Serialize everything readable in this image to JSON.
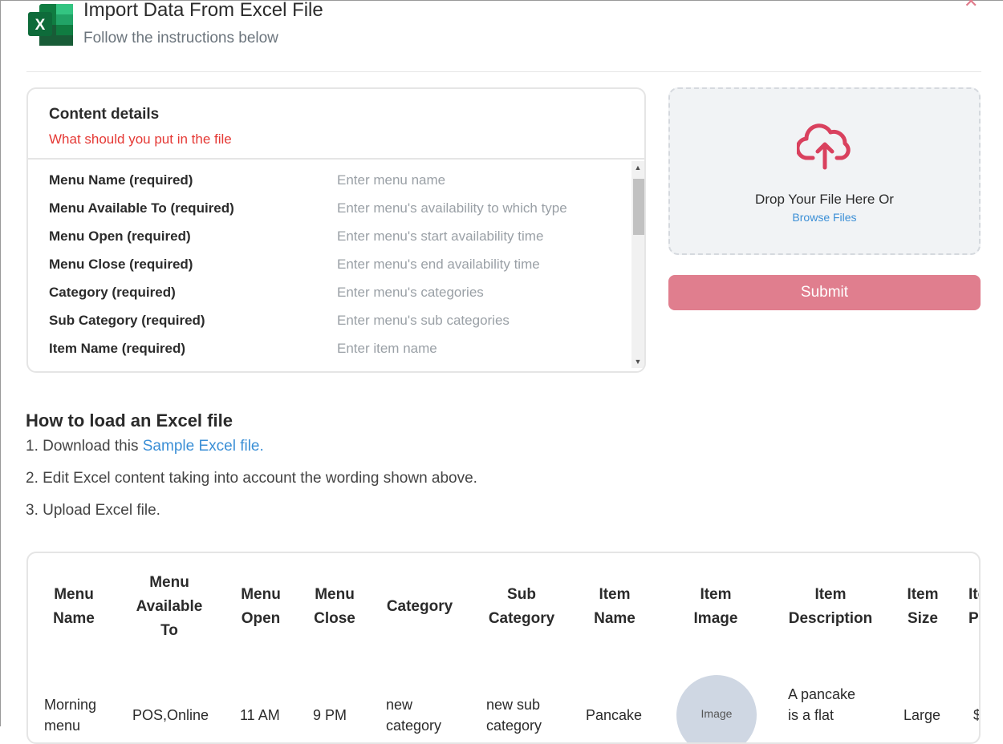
{
  "header": {
    "title": "Import Data From Excel File",
    "subtitle": "Follow the instructions below",
    "logo_letter": "X",
    "close_icon": "close-icon"
  },
  "content_details": {
    "title": "Content details",
    "subtitle": "What should you put in the file",
    "fields": [
      {
        "label": "Menu Name (required)",
        "hint": "Enter menu name"
      },
      {
        "label": "Menu Available To (required)",
        "hint": "Enter menu's availability to which type"
      },
      {
        "label": "Menu Open (required)",
        "hint": "Enter menu's start availability time"
      },
      {
        "label": "Menu Close (required)",
        "hint": "Enter menu's end availability time"
      },
      {
        "label": "Category (required)",
        "hint": "Enter menu's categories"
      },
      {
        "label": "Sub Category (required)",
        "hint": "Enter menu's sub categories"
      },
      {
        "label": "Item Name (required)",
        "hint": "Enter item name"
      }
    ]
  },
  "upload": {
    "drop_text": "Drop Your File Here Or",
    "browse_label": "Browse Files",
    "icon": "cloud-upload-icon",
    "submit_label": "Submit"
  },
  "how_to": {
    "title": "How to load an Excel file",
    "step1_prefix": "1. Download this ",
    "step1_link": "Sample Excel file.",
    "step2": "2. Edit Excel content taking into account the wording shown above.",
    "step3": "3. Upload Excel file."
  },
  "sample_table": {
    "headers": [
      "Menu Name",
      "Menu Available To",
      "Menu Open",
      "Menu Close",
      "Category",
      "Sub Category",
      "Item Name",
      "Item Image",
      "Item Description",
      "Item Size",
      "Item Price"
    ],
    "row": {
      "menu_name": "Morning menu",
      "menu_available_to": "POS,Online",
      "menu_open": "11 AM",
      "menu_close": "9 PM",
      "category": "new category",
      "sub_category": "new sub category",
      "item_name": "Pancake",
      "item_image": "Image",
      "item_description": "A pancake is a flat",
      "item_size": "Large",
      "item_price": "$"
    }
  },
  "colors": {
    "accent_red": "#e53935",
    "link_blue": "#3b8fd6",
    "submit_pink": "#e07e8e",
    "upload_icon": "#d9415e"
  }
}
